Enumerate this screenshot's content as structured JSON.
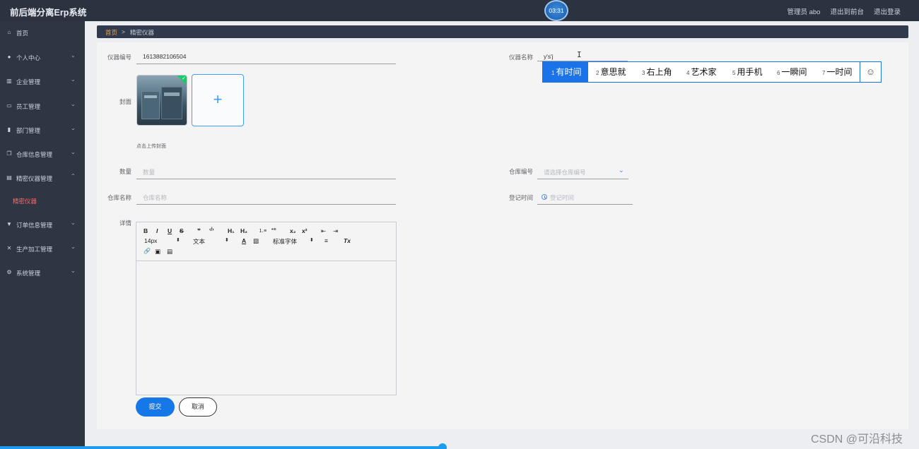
{
  "header": {
    "brand": "前后端分离Erp系统",
    "timer": "03:31",
    "user": "管理员 abo",
    "to_front": "退出到前台",
    "logout": "退出登录"
  },
  "sidebar": {
    "items": [
      {
        "label": "首页",
        "icon": "home-icon"
      },
      {
        "label": "个人中心",
        "icon": "user-icon"
      },
      {
        "label": "企业管理",
        "icon": "building-icon"
      },
      {
        "label": "员工管理",
        "icon": "id-card-icon"
      },
      {
        "label": "部门管理",
        "icon": "bar-chart-icon"
      },
      {
        "label": "仓库信息管理",
        "icon": "copy-icon"
      },
      {
        "label": "精密仪器管理",
        "icon": "box-icon"
      },
      {
        "label": "订单信息管理",
        "icon": "filter-icon"
      },
      {
        "label": "生产加工管理",
        "icon": "tools-icon"
      },
      {
        "label": "系统管理",
        "icon": "settings-icon"
      }
    ],
    "active_sub": "精密仪器"
  },
  "breadcrumb": {
    "home": "首页",
    "separator": ">",
    "current": "精密仪器"
  },
  "form": {
    "code_label": "仪器编号",
    "code_value": "1613882106504",
    "name_label": "仪器名称",
    "name_value": "y's'j",
    "cover_label": "封面",
    "upload_plus": "+",
    "upload_tip": "点击上传封面",
    "qty_label": "数量",
    "qty_placeholder": "数量",
    "warehouse_code_label": "仓库编号",
    "warehouse_code_placeholder": "请选择仓库编号",
    "warehouse_name_label": "仓库名称",
    "warehouse_name_placeholder": "仓库名称",
    "register_time_label": "登记时间",
    "register_time_placeholder": "登记时间",
    "detail_label": "详情",
    "submit": "提交",
    "cancel": "取消"
  },
  "editor_toolbar": {
    "bold": "B",
    "italic": "I",
    "underline": "U",
    "strike": "S",
    "quote": "❞",
    "code": "‹/›",
    "h1": "H₁",
    "h2": "H₂",
    "ol": "⒈≡",
    "ul": "•≡",
    "sub": "x₂",
    "sup": "x²",
    "outdent": "⇤",
    "indent": "⇥",
    "size": "14px",
    "size_arrow": "⬍",
    "text_type": "文本",
    "text_arrow": "⬍",
    "font_color": "A",
    "bg_color": "▨",
    "font_family": "标准字体",
    "font_arrow": "⬍",
    "align": "≡",
    "clean": "Tx",
    "link": "🔗",
    "image": "▣",
    "video": "▤"
  },
  "ime": {
    "candidates": [
      {
        "num": "1",
        "text": "有时间"
      },
      {
        "num": "2",
        "text": "意思就"
      },
      {
        "num": "3",
        "text": "右上角"
      },
      {
        "num": "4",
        "text": "艺术家"
      },
      {
        "num": "5",
        "text": "用手机"
      },
      {
        "num": "6",
        "text": "一瞬间"
      },
      {
        "num": "7",
        "text": "一时间"
      }
    ],
    "emoji": "☺"
  },
  "cursor": "I",
  "watermark": "CSDN @可沿科技",
  "colors": {
    "accent": "#1677e8",
    "sidebar_bg": "#2e3543",
    "topbar_bg": "#2b3240",
    "active_red": "#f56c6c",
    "crumb_home": "#f0a24a"
  }
}
